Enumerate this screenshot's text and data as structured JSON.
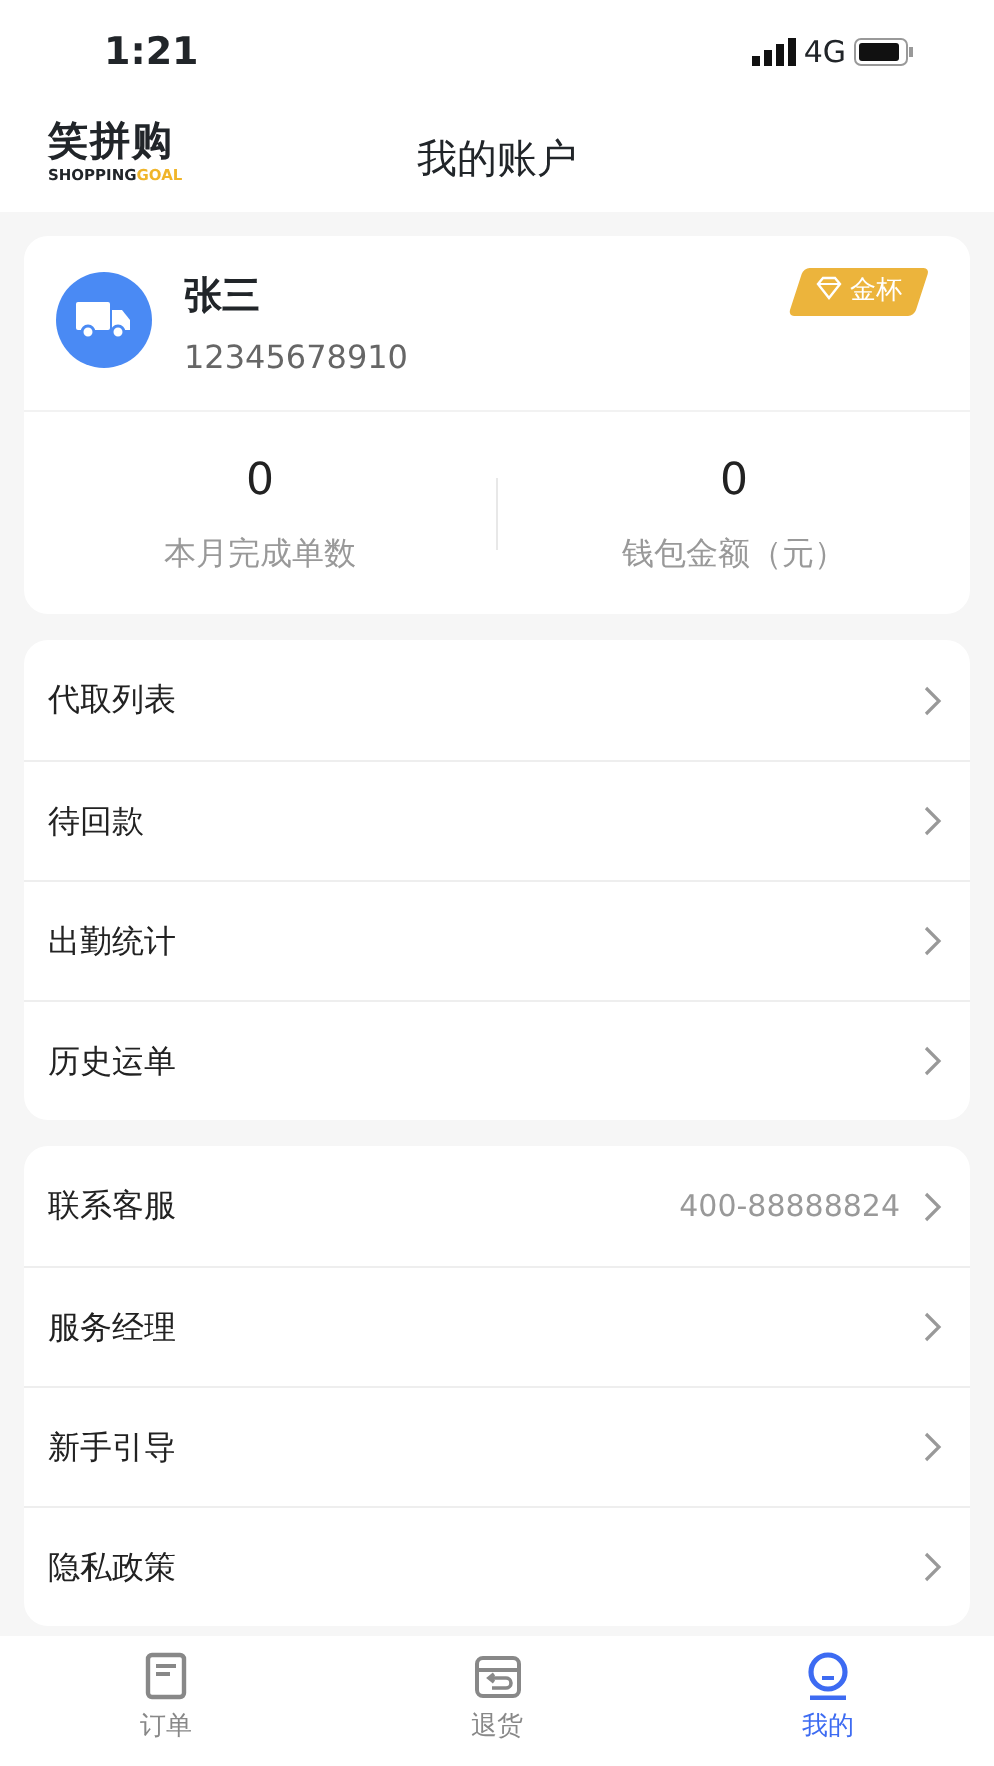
{
  "status_bar": {
    "time": "1:21",
    "network": "4G"
  },
  "header": {
    "logo_name": "笑拼购",
    "logo_tagline_dark": "SHOPPING",
    "logo_tagline_accent": "GOAL",
    "title": "我的账户"
  },
  "profile": {
    "name": "张三",
    "phone": "12345678910",
    "badge": "金杯",
    "stats": [
      {
        "value": "0",
        "label": "本月完成单数"
      },
      {
        "value": "0",
        "label": "钱包金额（元）"
      }
    ]
  },
  "menu_groups": [
    [
      {
        "label": "代取列表"
      },
      {
        "label": "待回款"
      },
      {
        "label": "出勤统计"
      },
      {
        "label": "历史运单"
      }
    ],
    [
      {
        "label": "联系客服",
        "value": "400-88888824"
      },
      {
        "label": "服务经理"
      },
      {
        "label": "新手引导"
      },
      {
        "label": "隐私政策"
      }
    ]
  ],
  "tab_bar": [
    {
      "label": "订单",
      "selected": false
    },
    {
      "label": "退货",
      "selected": false
    },
    {
      "label": "我的",
      "selected": true
    }
  ]
}
